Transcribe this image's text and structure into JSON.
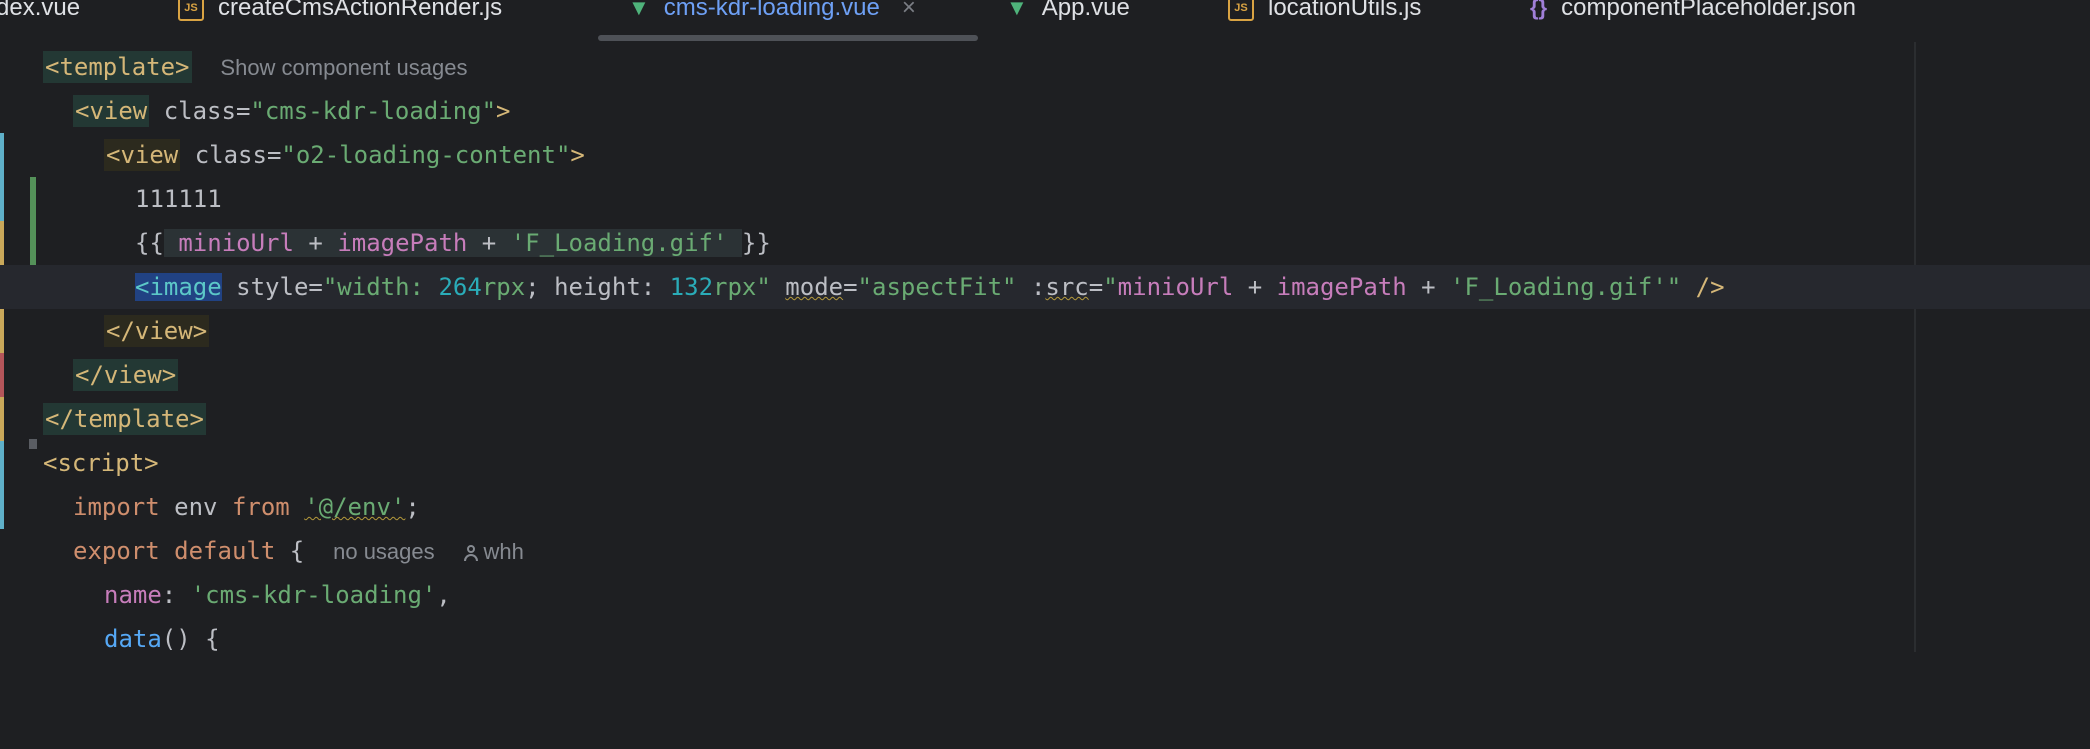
{
  "tabs": [
    {
      "label": "dex.vue",
      "icon": "none"
    },
    {
      "label": "createCmsActionRender.js",
      "icon": "js-file-icon"
    },
    {
      "label": "cms-kdr-loading.vue",
      "icon": "vue-file-icon",
      "active": true,
      "close": "×"
    },
    {
      "label": "App.vue",
      "icon": "vue-file-icon"
    },
    {
      "label": "locationUtils.js",
      "icon": "js-file-icon"
    },
    {
      "label": "componentPlaceholder.json",
      "icon": "json-file-icon"
    }
  ],
  "icons": {
    "js": "JS",
    "vue": "▼",
    "json": "{}"
  },
  "code": {
    "l1_tag_open": "<template>",
    "l1_hint": "Show component usages",
    "l2_tag": "<view",
    "l2_attr": " class=",
    "l2_val": "\"cms-kdr-loading\"",
    "l2_end": ">",
    "l3_tag": "<view",
    "l3_attr": " class=",
    "l3_val": "\"o2-loading-content\"",
    "l3_end": ">",
    "l4_text": "111111",
    "l5_open": "{{",
    "l5_var1": "minioUrl",
    "l5_plus1": " + ",
    "l5_var2": "imagePath",
    "l5_plus2": " + ",
    "l5_str": "'F_Loading.gif'",
    "l5_close": "}}",
    "l6_lt": "<",
    "l6_tag": "image",
    "l6_style_attr": " style=",
    "l6_q1": "\"width: ",
    "l6_n1": "264",
    "l6_u1": "rpx",
    "l6_mid": "; height: ",
    "l6_n2": "132",
    "l6_u2": "rpx",
    "l6_q2": "\" ",
    "l6_mode": "mode",
    "l6_eq": "=",
    "l6_modeval": "\"aspectFit\"",
    "l6_sp": " :",
    "l6_src": "src",
    "l6_eq2": "=",
    "l6_q3": "\"",
    "l6_v1": "minioUrl",
    "l6_p1": " + ",
    "l6_v2": "imagePath",
    "l6_p2": " + ",
    "l6_s": "'F_Loading.gif'",
    "l6_q4": "\"",
    "l6_end": " />",
    "l7_tag": "</view>",
    "l8_tag": "</view>",
    "l9_tag": "</template>",
    "l10_tag": "<script>",
    "l11_kw1": "import",
    "l11_id": " env ",
    "l11_kw2": "from",
    "l11_sp": " ",
    "l11_str": "'@/env'",
    "l11_semi": ";",
    "l12_kw1": "export",
    "l12_kw2": " default",
    "l12_brace": " {",
    "l12_hint1": "no usages",
    "l12_hint2": "whh",
    "l13_key": "name",
    "l13_colon": ": ",
    "l13_str": "'cms-kdr-loading'",
    "l13_comma": ",",
    "l14_fn": "data",
    "l14_rest": "() {"
  },
  "colors": {
    "background": "#1e1f22",
    "tag": "#d5b778",
    "string": "#6aab73",
    "number": "#2aacb8",
    "variable": "#c77dbb",
    "keyword": "#cf8e6d",
    "function": "#56a8f5",
    "active_tab": "#6ea0f5"
  }
}
